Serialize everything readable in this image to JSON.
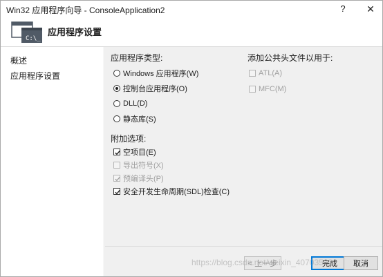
{
  "window": {
    "title": "Win32 应用程序向导 - ConsoleApplication2",
    "help_glyph": "?",
    "close_glyph": "✕"
  },
  "header": {
    "heading": "应用程序设置",
    "icon": "console-window-icon",
    "icon_text": "C:\\_"
  },
  "sidebar": {
    "items": [
      {
        "label": "概述"
      },
      {
        "label": "应用程序设置"
      }
    ]
  },
  "app_type": {
    "label": "应用程序类型:",
    "options": [
      {
        "label": "Windows 应用程序(W)",
        "checked": false
      },
      {
        "label": "控制台应用程序(O)",
        "checked": true
      },
      {
        "label": "DLL(D)",
        "checked": false
      },
      {
        "label": "静态库(S)",
        "checked": false
      }
    ]
  },
  "additional": {
    "label": "附加选项:",
    "options": [
      {
        "label": "空项目(E)",
        "checked": true,
        "enabled": true
      },
      {
        "label": "导出符号(X)",
        "checked": false,
        "enabled": false
      },
      {
        "label": "预编译头(P)",
        "checked": true,
        "enabled": false
      },
      {
        "label": "安全开发生命周期(SDL)检查(C)",
        "checked": true,
        "enabled": true
      }
    ]
  },
  "common_headers": {
    "label": "添加公共头文件以用于:",
    "options": [
      {
        "label": "ATL(A)",
        "checked": false,
        "enabled": false
      },
      {
        "label": "MFC(M)",
        "checked": false,
        "enabled": false
      }
    ]
  },
  "buttons": {
    "back": "< 上一步",
    "finish": "完成",
    "cancel": "取消"
  },
  "watermark": "https://blog.csdn.net/weixin_40703522",
  "colors": {
    "content_bg": "#f0f0f0",
    "accent": "#0078d7",
    "icon_bg": "#505a66"
  }
}
